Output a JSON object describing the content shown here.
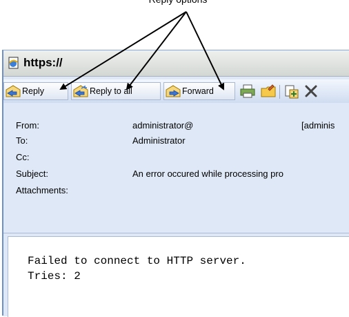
{
  "annotation": {
    "text": "Reply options"
  },
  "window": {
    "title": "https://"
  },
  "toolbar": {
    "reply_label": "Reply",
    "reply_all_label": "Reply to all",
    "forward_label": "Forward"
  },
  "header": {
    "from_label": "From:",
    "from_value": "administrator@",
    "from_value_right": "[adminis",
    "to_label": "To:",
    "to_value": "Administrator",
    "cc_label": "Cc:",
    "subject_label": "Subject:",
    "subject_value": "An error occured while processing pro",
    "attachments_label": "Attachments:"
  },
  "message": {
    "line1": "Failed to connect to HTTP server.",
    "line2": "Tries: 2"
  },
  "colors": {
    "window_border": "#6d8fc2",
    "header_bg": "#dee8f6",
    "toolbar_bg": "#cfdcf1"
  }
}
